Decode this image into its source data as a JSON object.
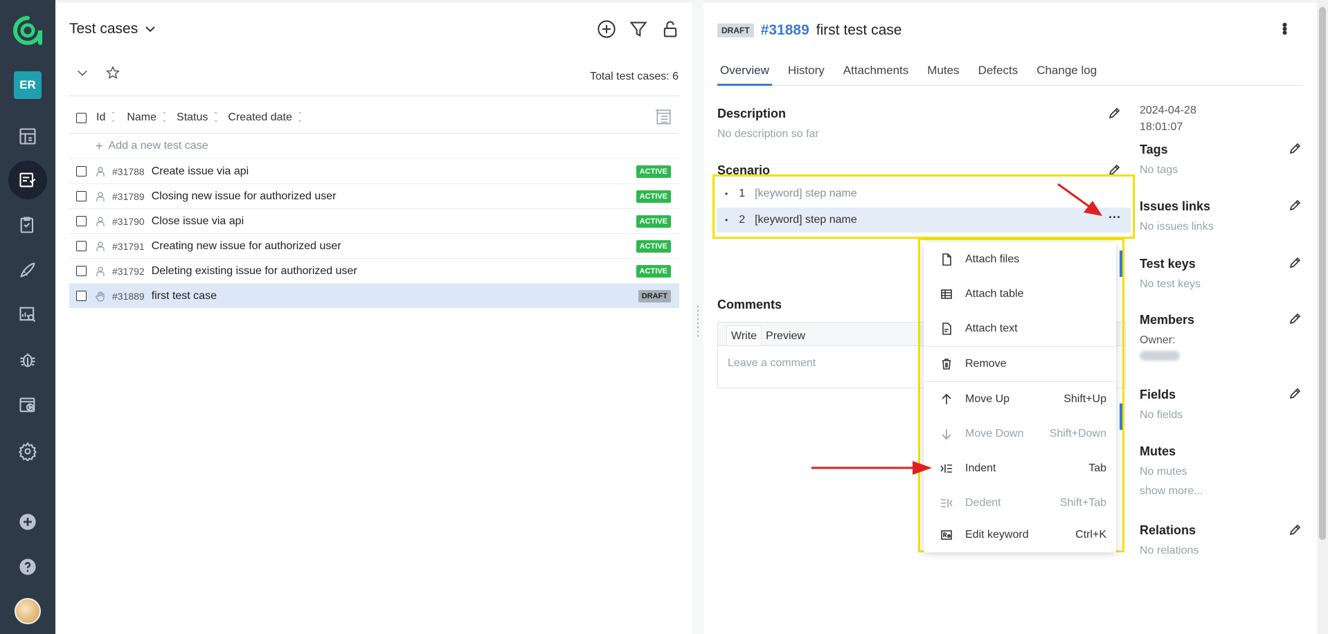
{
  "nav": {
    "user_initials": "ER",
    "icons": [
      "dashboard-icon",
      "test-cases-icon",
      "test-plans-icon",
      "launches-icon",
      "analytics-icon",
      "defects-icon",
      "jobs-icon",
      "settings-icon",
      "add-icon",
      "help-icon"
    ]
  },
  "list": {
    "title": "Test cases",
    "total": "Total test cases: 6",
    "columns": {
      "id": "Id",
      "name": "Name",
      "status": "Status",
      "created": "Created date"
    },
    "add_placeholder": "Add a new test case",
    "rows": [
      {
        "id": "#31788",
        "name": "Create issue via api",
        "status": "ACTIVE"
      },
      {
        "id": "#31789",
        "name": "Closing new issue for authorized user",
        "status": "ACTIVE"
      },
      {
        "id": "#31790",
        "name": "Close issue via api",
        "status": "ACTIVE"
      },
      {
        "id": "#31791",
        "name": "Creating new issue for authorized user",
        "status": "ACTIVE"
      },
      {
        "id": "#31792",
        "name": "Deleting existing issue for authorized user",
        "status": "ACTIVE"
      },
      {
        "id": "#31889",
        "name": "first test case",
        "status": "DRAFT"
      }
    ]
  },
  "detail": {
    "badge": "DRAFT",
    "number": "#31889",
    "name": "first test case",
    "tabs": [
      "Overview",
      "History",
      "Attachments",
      "Mutes",
      "Defects",
      "Change log"
    ],
    "description_title": "Description",
    "description_empty": "No description so far",
    "scenario_title": "Scenario",
    "steps": [
      {
        "num": "1",
        "text": "[keyword] step name"
      },
      {
        "num": "2",
        "text": "[keyword] step name"
      }
    ],
    "comments_title": "Comments",
    "comment_tabs": [
      "Write",
      "Preview"
    ],
    "comment_placeholder": "Leave a comment"
  },
  "side": {
    "date": "2024-04-28",
    "time": "18:01:07",
    "tags_title": "Tags",
    "tags_empty": "No tags",
    "issues_title": "Issues links",
    "issues_empty": "No issues links",
    "keys_title": "Test keys",
    "keys_empty": "No test keys",
    "members_title": "Members",
    "owner_label": "Owner:",
    "fields_title": "Fields",
    "fields_empty": "No fields",
    "mutes_title": "Mutes",
    "mutes_empty": "No mutes",
    "show_more": "show more...",
    "relations_title": "Relations",
    "relations_empty": "No relations"
  },
  "menu": {
    "items": [
      {
        "label": "Attach files",
        "shortcut": "",
        "icon": "file-icon",
        "disabled": false
      },
      {
        "label": "Attach table",
        "shortcut": "",
        "icon": "table-icon",
        "disabled": false
      },
      {
        "label": "Attach text",
        "shortcut": "",
        "icon": "text-file-icon",
        "disabled": false
      },
      {
        "label": "Remove",
        "shortcut": "",
        "icon": "trash-icon",
        "disabled": false
      },
      {
        "label": "Move Up",
        "shortcut": "Shift+Up",
        "icon": "arrow-up-icon",
        "disabled": false
      },
      {
        "label": "Move Down",
        "shortcut": "Shift+Down",
        "icon": "arrow-down-icon",
        "disabled": true
      },
      {
        "label": "Indent",
        "shortcut": "Tab",
        "icon": "indent-icon",
        "disabled": false
      },
      {
        "label": "Dedent",
        "shortcut": "Shift+Tab",
        "icon": "dedent-icon",
        "disabled": true
      },
      {
        "label": "Edit keyword",
        "shortcut": "Ctrl+K",
        "icon": "keyword-icon",
        "disabled": false
      }
    ]
  },
  "colors": {
    "nav_bg": "#2f3a48",
    "accent": "#3b7bd4",
    "active_badge": "#2db84d",
    "highlight_outline": "#f2e000",
    "annotation_arrow": "#e02020"
  }
}
